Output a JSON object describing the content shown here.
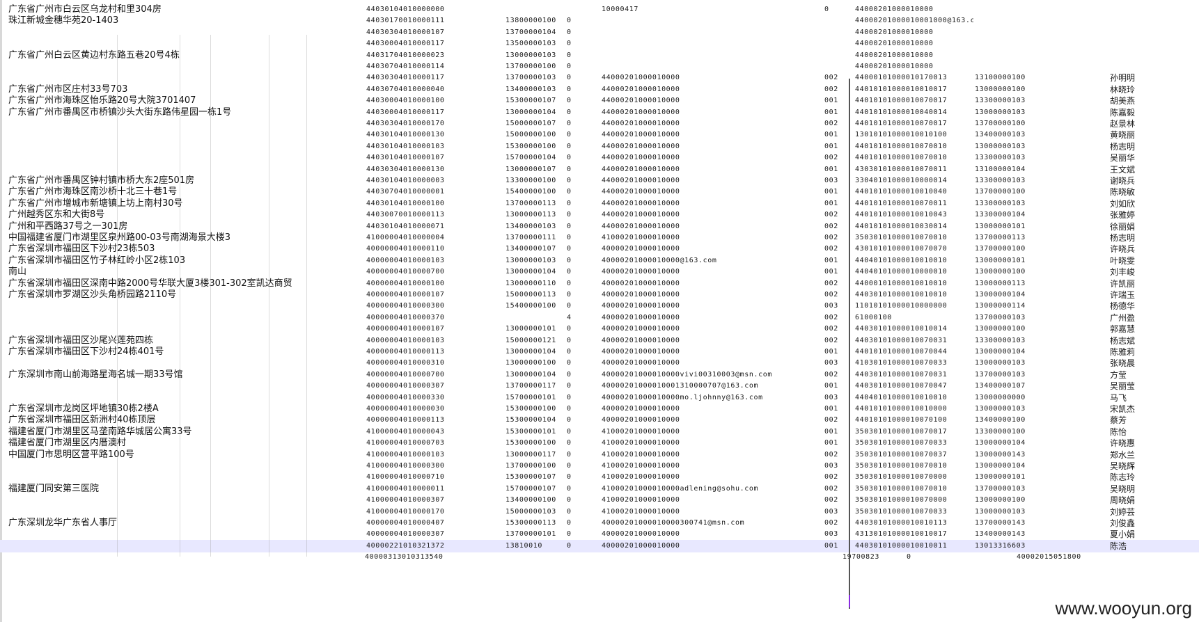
{
  "editor": {
    "rows": [
      [
        "广东省广州市白云区乌龙村和里304房",
        "44030104010000000",
        "",
        "",
        "10000417",
        "0",
        "44000201000010000",
        "",
        ""
      ],
      [
        "珠江新城金穗华苑20-1403",
        "44030170010000111",
        "13800000100",
        "0",
        "",
        "",
        "44000201000010001000@163.com",
        "",
        ""
      ],
      [
        "",
        "44030304010000107",
        "13700000104",
        "0",
        "",
        "",
        "44000201000010000",
        "",
        ""
      ],
      [
        "",
        "44030004010000117",
        "13500000103",
        "0",
        "",
        "",
        "44000201000010000",
        "",
        ""
      ],
      [
        "广东省广州白云区黄边村东路五巷20号4栋",
        "44031704010000023",
        "13000000103",
        "0",
        "",
        "",
        "44000201000010000",
        "",
        ""
      ],
      [
        "",
        "44030704010000114",
        "13700000100",
        "0",
        "",
        "",
        "44000201000010000",
        "",
        ""
      ],
      [
        "",
        "44030304010000117",
        "13700000103",
        "0",
        "44000201000010000",
        "002",
        "44000101000010170013",
        "13100000100",
        "孙明明"
      ],
      [
        "广东省广州市区庄村33号703",
        "44030704010000040",
        "13400000103",
        "0",
        "44000201000010000",
        "002",
        "44010101000010010017",
        "13000000100",
        "林晓玲"
      ],
      [
        "广东省广州市海珠区怡乐路20号大院3701407",
        "44030004010000100",
        "15300000107",
        "0",
        "44000201000010000",
        "001",
        "44010101000010070017",
        "13300000103",
        "胡美燕"
      ],
      [
        "广东省广州市番禺区市桥镇沙头大街东路伟星园一栋1号",
        "44030004010000117",
        "13000000104",
        "0",
        "44000201000010000",
        "001",
        "44010101000010040014",
        "13000000103",
        "陈嘉毅"
      ],
      [
        "",
        "44030304010000170",
        "15000000107",
        "0",
        "44000201000010000",
        "002",
        "44010101000010070017",
        "13700000100",
        "赵景林"
      ],
      [
        "",
        "44030104010000130",
        "15000000100",
        "0",
        "44000201000010000",
        "001",
        "13010101000010010100",
        "13400000103",
        "黄晓丽"
      ],
      [
        "",
        "44030104010000103",
        "15300000100",
        "0",
        "44000201000010000",
        "001",
        "44010101000010070010",
        "13000000103",
        "杨志明"
      ],
      [
        "",
        "44030104010000107",
        "15700000104",
        "0",
        "44000201000010000",
        "002",
        "44010101000010070010",
        "13300000103",
        "吴丽华"
      ],
      [
        "",
        "44030304010000130",
        "13000000107",
        "0",
        "44000201000010000",
        "001",
        "43030101000010070011",
        "13100000104",
        "王文斌"
      ],
      [
        "广东省广州市番禺区钟村镇市桥大东2座501房",
        "44030104010000003",
        "13300000100",
        "0",
        "44000201000010000",
        "003",
        "33040101000010000014",
        "13300000103",
        "谢晓兵"
      ],
      [
        "广东省广州市海珠区南沙桥十北三十巷1号",
        "44030704010000001",
        "15400000100",
        "0",
        "44000201000010000",
        "001",
        "44010101000010010040",
        "13700000100",
        "陈晓敏"
      ],
      [
        "广东省广州市增城市新塘镇上坊上南村30号",
        "44030104010000100",
        "13700000113",
        "0",
        "44000201000010000",
        "001",
        "44010101000010070011",
        "13300000103",
        "刘如欣"
      ],
      [
        "广州越秀区东和大街8号",
        "44030070010000113",
        "13000000113",
        "0",
        "44000201000010000",
        "002",
        "44010101000010010043",
        "13300000104",
        "张雅婷"
      ],
      [
        "广州和平西路37号之一301房",
        "44030104010000071",
        "13400000103",
        "0",
        "44000201000010000",
        "002",
        "44010101000010030014",
        "13000000101",
        "徐丽娟"
      ],
      [
        "中国福建省厦门市湖里区泉州路00-03号南湖海景大楼3",
        "41000004010000004",
        "13700000111",
        "0",
        "41000201000010000",
        "002",
        "35030101000010070010",
        "13700000113",
        "杨志明"
      ],
      [
        "广东省深圳市福田区下沙村23栋503",
        "40000004010000110",
        "13400000107",
        "0",
        "40000201000010000",
        "002",
        "43010101000010070070",
        "13700000100",
        "许晓兵"
      ],
      [
        "广东省深圳市福田区竹子林红岭小区2栋103",
        "40000004010000103",
        "13000000103",
        "0",
        "40000201000010000@163.com",
        "001",
        "44040101000010010010",
        "13000000101",
        "叶晓雯"
      ],
      [
        "南山",
        "40000004010000700",
        "13000000104",
        "0",
        "40000201000010000",
        "001",
        "44040101000010000010",
        "13000000100",
        "刘丰峻"
      ],
      [
        "广东省深圳市福田区深南中路2000号华联大厦3楼301-302室凯达商贸",
        "40000004010000100",
        "13000000110",
        "0",
        "40000201000010000",
        "002",
        "44000101000010010010",
        "13000000113",
        "许凯丽"
      ],
      [
        "广东省深圳市罗湖区沙头角桥园路2110号",
        "40000004010000107",
        "15000000113",
        "0",
        "40000201000010000",
        "002",
        "44030101000010010010",
        "13000000104",
        "许瑞玉"
      ],
      [
        "",
        "40000004010000300",
        "15400000100",
        "0",
        "40000201000010000",
        "003",
        "11010101000010000000",
        "13000000114",
        "杨德华"
      ],
      [
        "",
        "40000004010000370",
        "",
        "4",
        "40000201000010000",
        "002",
        "61000100",
        "13700000103",
        "广州盈"
      ],
      [
        "",
        "40000004010000107",
        "13000000101",
        "0",
        "40000201000010000",
        "002",
        "44030101000010010014",
        "13000000100",
        "郭嘉慧"
      ],
      [
        "广东省深圳市福田区沙尾兴莲苑四栋",
        "40000004010000103",
        "15000000121",
        "0",
        "40000201000010000",
        "002",
        "44030101000010070031",
        "13300000103",
        "杨志斌"
      ],
      [
        "广东省深圳市福田区下沙村24栋401号",
        "40000004010000113",
        "13000000104",
        "0",
        "40000201000010000",
        "001",
        "44010101000010070044",
        "13000000104",
        "陈雅莉"
      ],
      [
        "",
        "40000004010000310",
        "13000000100",
        "0",
        "40000201000010000",
        "003",
        "41030101000010070033",
        "13000000103",
        "张晓晨"
      ],
      [
        "广东深圳市南山前海路星海名城一期33号馆",
        "40000004010000700",
        "13000000104",
        "0",
        "40000201000010000vivi00310003@msn.com",
        "002",
        "44030101000010070031",
        "13700000103",
        "方莹"
      ],
      [
        "",
        "40000004010000307",
        "13700000117",
        "0",
        "40000201000010001310000707@163.com",
        "001",
        "44030101000010070047",
        "13400000107",
        "吴丽莹"
      ],
      [
        "",
        "40000004010000330",
        "15700000101",
        "0",
        "40000201000010000mo.ljohnny@163.com",
        "003",
        "44040101000010010010",
        "13000000000",
        "马飞"
      ],
      [
        "广东省深圳市龙岗区坪地镇30栋2楼A",
        "40000004010000030",
        "15300000100",
        "0",
        "40000201000010000",
        "001",
        "44010101000010010000",
        "13000000103",
        "宋凯杰"
      ],
      [
        "广东省深圳市福田区新洲村40栋顶层",
        "40000004010000113",
        "15300000104",
        "0",
        "40000201000010000",
        "002",
        "44010101000010070100",
        "13400000100",
        "蔡芳"
      ],
      [
        "福建省厦门市湖里区马垄南路华城居公寓33号",
        "41000004010000043",
        "15300000101",
        "0",
        "41000201000010000",
        "001",
        "35030101000010070017",
        "13300000100",
        "陈怡"
      ],
      [
        "福建省厦门市湖里区内厝澳村",
        "41000004010000703",
        "15300000100",
        "0",
        "41000201000010000",
        "001",
        "35030101000010070033",
        "13000000104",
        "许晓惠"
      ],
      [
        "中国厦门市思明区营平路100号",
        "41000004010000103",
        "13000000117",
        "0",
        "41000201000010000",
        "002",
        "35030101000010070037",
        "13000000143",
        "郑水兰"
      ],
      [
        "",
        "41000004010000300",
        "13700000100",
        "0",
        "41000201000010000",
        "003",
        "35030101000010070010",
        "13000000104",
        "吴晓辉"
      ],
      [
        "",
        "41000004010000710",
        "15300000107",
        "0",
        "41000201000010000",
        "002",
        "35030101000010070000",
        "13000000101",
        "陈志玲"
      ],
      [
        "福建厦门同安第三医院",
        "41000004010000011",
        "15700000107",
        "0",
        "41000201000010000adlening@sohu.com",
        "002",
        "35030101000010070010",
        "13700000103",
        "吴晓明"
      ],
      [
        "",
        "41000004010000307",
        "13400000100",
        "0",
        "41000201000010000",
        "002",
        "35030101000010070000",
        "13000000100",
        "周晓娟"
      ],
      [
        "",
        "41000004010000170",
        "15000000103",
        "0",
        "41000201000010000",
        "003",
        "35030101000010070033",
        "13000000103",
        "刘婷芸"
      ],
      [
        "广东深圳龙华广东省人事厅",
        "40000004010000407",
        "15300000113",
        "0",
        "40000201000010000300741@msn.com",
        "002",
        "44030101000010010113",
        "13700000143",
        "刘俊鑫"
      ],
      [
        "",
        "40000004010000307",
        "13700000101",
        "0",
        "40000201000010000",
        "003",
        "43130101000010010017",
        "13400000143",
        "夏小娟"
      ],
      [
        "",
        "40000221010321372",
        "13810010",
        "0",
        "40000201000010000",
        "001",
        "44030101000010010011",
        "13013316603",
        "陈浩"
      ]
    ],
    "last_line": {
      "id": "40000313010313540",
      "date": "19700823",
      "flag": "0",
      "code": "40002015051800"
    }
  },
  "watermark": {
    "text": "www.wooyun.org"
  }
}
